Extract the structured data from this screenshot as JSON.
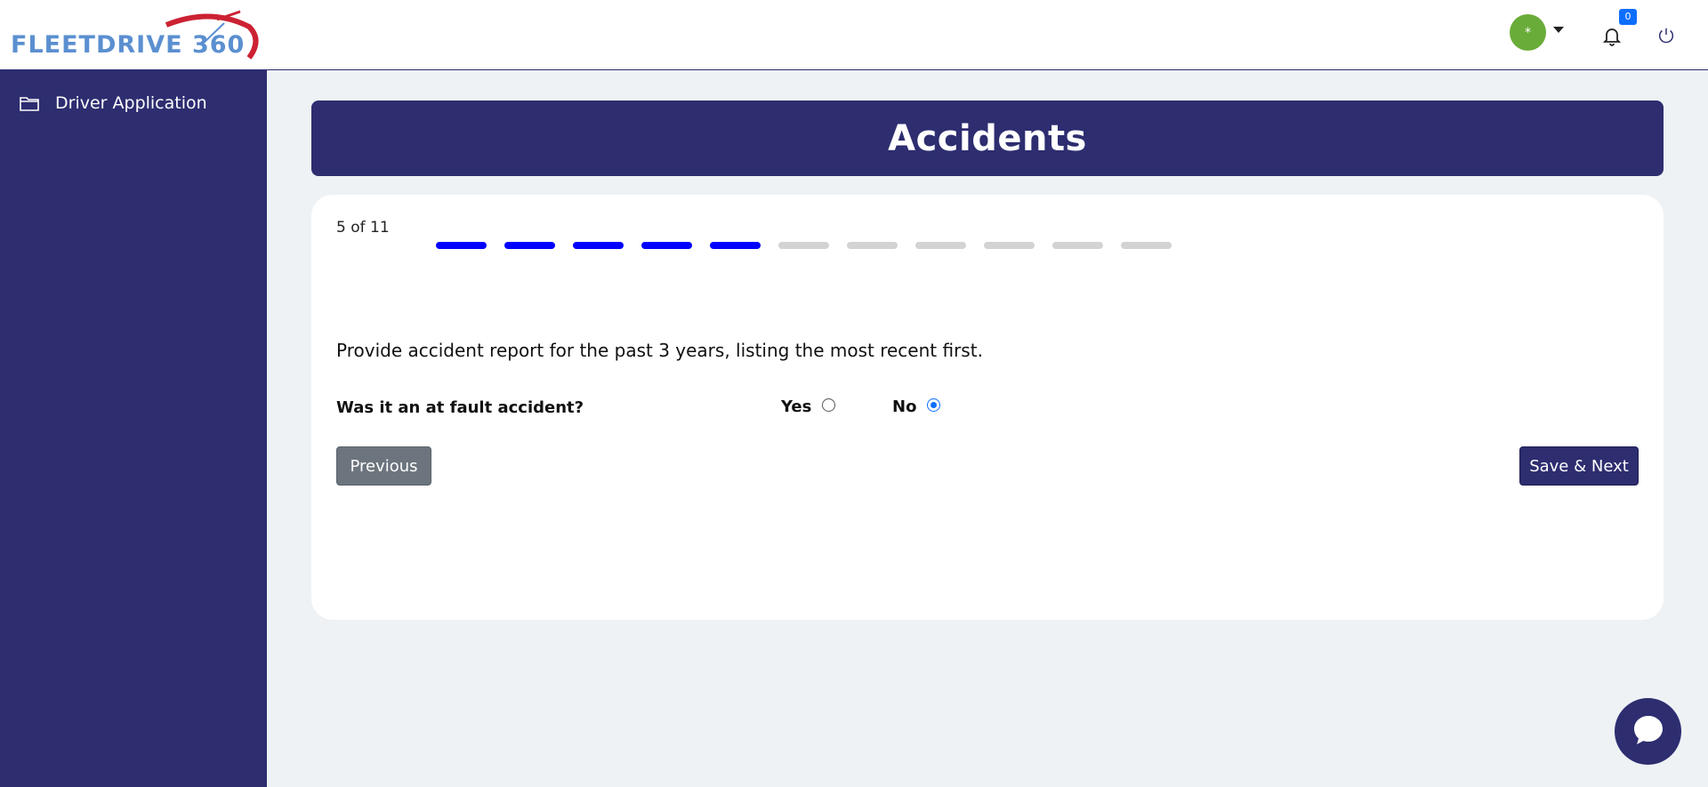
{
  "header": {
    "logo_text": "FLEETDRIVE 360",
    "avatar_symbol": "*",
    "notification_count": "0"
  },
  "sidebar": {
    "items": [
      {
        "label": "Driver Application",
        "icon": "folder-icon"
      }
    ]
  },
  "page": {
    "title": "Accidents"
  },
  "form": {
    "step_text": "5 of 11",
    "progress": {
      "current": 5,
      "total": 11
    },
    "instructions": "Provide accident report for the past 3 years, listing the most recent first.",
    "question": "Was it an at fault accident?",
    "options": [
      {
        "label": "Yes",
        "checked": false
      },
      {
        "label": "No",
        "checked": true
      }
    ],
    "previous_label": "Previous",
    "next_label": "Save & Next"
  },
  "colors": {
    "brand_navy": "#2d2d70",
    "progress_done": "#0000ff",
    "progress_todo": "#d3d3d3",
    "avatar_green": "#6aac3a",
    "badge_blue": "#0d6efd",
    "logo_blue": "#5b8fd0",
    "logo_red": "#cc2233"
  }
}
